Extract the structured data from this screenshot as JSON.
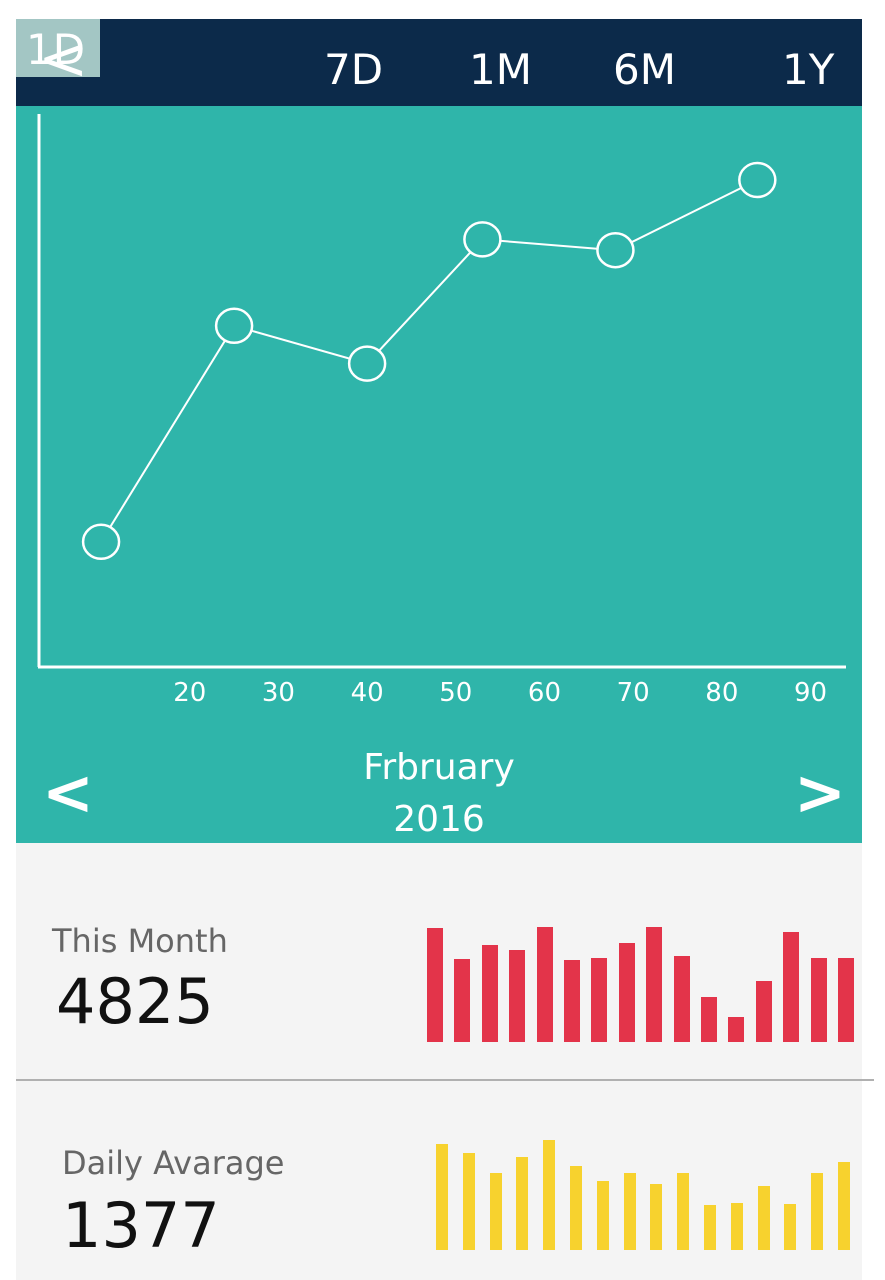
{
  "topbar": {
    "back_label": "<",
    "ranges": [
      "1D",
      "7D",
      "1M",
      "6M",
      "1Y"
    ],
    "selected_range": "1D"
  },
  "chart_data": {
    "type": "line",
    "x_ticks": [
      20,
      30,
      40,
      50,
      60,
      70,
      80,
      90
    ],
    "x": [
      10,
      25,
      40,
      53,
      68,
      84
    ],
    "y": [
      23,
      63,
      56,
      79,
      77,
      90
    ],
    "xlim": [
      3,
      94
    ],
    "ylim": [
      0,
      100
    ]
  },
  "period": {
    "month": "Frbruary",
    "year": "2016",
    "prev_label": "<",
    "next_label": ">"
  },
  "stats": {
    "this_month": {
      "label": "This Month",
      "value": "4825",
      "bar_color": "#e3344a",
      "bars": [
        92,
        67,
        78,
        74,
        93,
        66,
        68,
        80,
        93,
        69,
        36,
        20,
        49,
        89,
        68,
        68
      ]
    },
    "daily_average": {
      "label": "Daily Avarage",
      "value": "1377",
      "bar_color": "#f7d22e",
      "bars": [
        96,
        88,
        70,
        85,
        100,
        76,
        63,
        70,
        60,
        70,
        41,
        43,
        58,
        42,
        70,
        80
      ]
    }
  },
  "colors": {
    "topbar": "#0c2a4a",
    "chart_bg": "#2fb5aa",
    "selected_range_bg": "#a3c6c4",
    "panel_bg": "#f4f4f4"
  }
}
